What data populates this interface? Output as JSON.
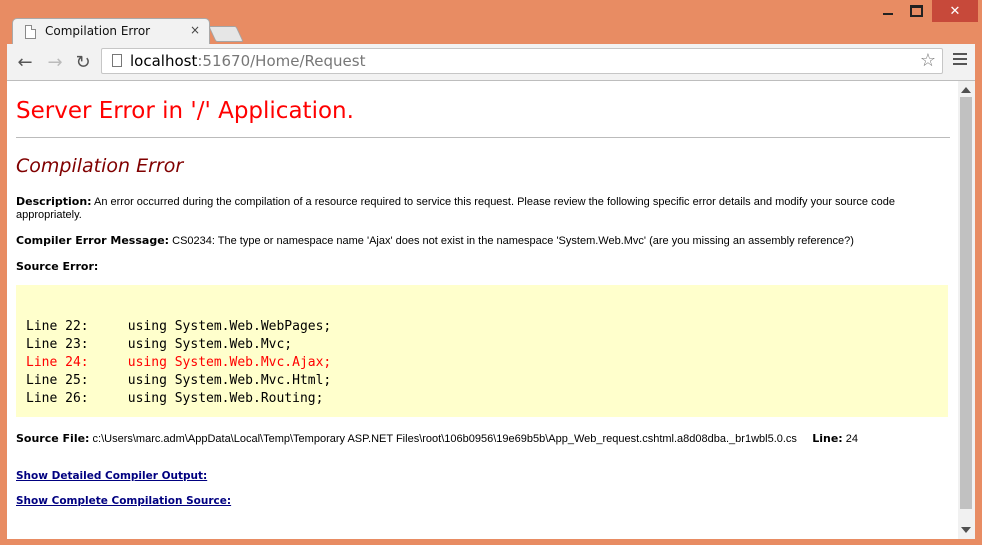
{
  "browser": {
    "tab_title": "Compilation Error",
    "tab_close": "×",
    "url_host": "localhost",
    "url_rest": ":51670/Home/Request",
    "back_icon": "←",
    "forward_icon": "→",
    "reload_icon": "↻",
    "star_icon": "☆",
    "window_close": "✕"
  },
  "page": {
    "title": "Server Error in '/' Application.",
    "subtitle": "Compilation Error",
    "description_label": "Description:",
    "description_text": "An error occurred during the compilation of a resource required to service this request. Please review the following specific error details and modify your source code appropriately.",
    "compiler_label": "Compiler Error Message:",
    "compiler_text": "CS0234: The type or namespace name 'Ajax' does not exist in the namespace 'System.Web.Mvc' (are you missing an assembly reference?)",
    "source_error_label": "Source Error:",
    "code_lines": [
      {
        "line": "Line 22:",
        "code": "using System.Web.WebPages;",
        "error": false
      },
      {
        "line": "Line 23:",
        "code": "using System.Web.Mvc;",
        "error": false
      },
      {
        "line": "Line 24:",
        "code": "using System.Web.Mvc.Ajax;",
        "error": true
      },
      {
        "line": "Line 25:",
        "code": "using System.Web.Mvc.Html;",
        "error": false
      },
      {
        "line": "Line 26:",
        "code": "using System.Web.Routing;",
        "error": false
      }
    ],
    "source_file_label": "Source File:",
    "source_file_path": "c:\\Users\\marc.adm\\AppData\\Local\\Temp\\Temporary ASP.NET Files\\root\\106b0956\\19e69b5b\\App_Web_request.cshtml.a8d08dba._br1wbl5.0.cs",
    "line_label": "Line:",
    "line_value": "24",
    "link_compiler_output": "Show Detailed Compiler Output:",
    "link_compilation_source": "Show Complete Compilation Source:"
  },
  "colors": {
    "title": "#ff0000",
    "subtitle": "#800000",
    "code_bg": "#ffffcc",
    "link": "#000080",
    "frame": "#e88c63"
  }
}
